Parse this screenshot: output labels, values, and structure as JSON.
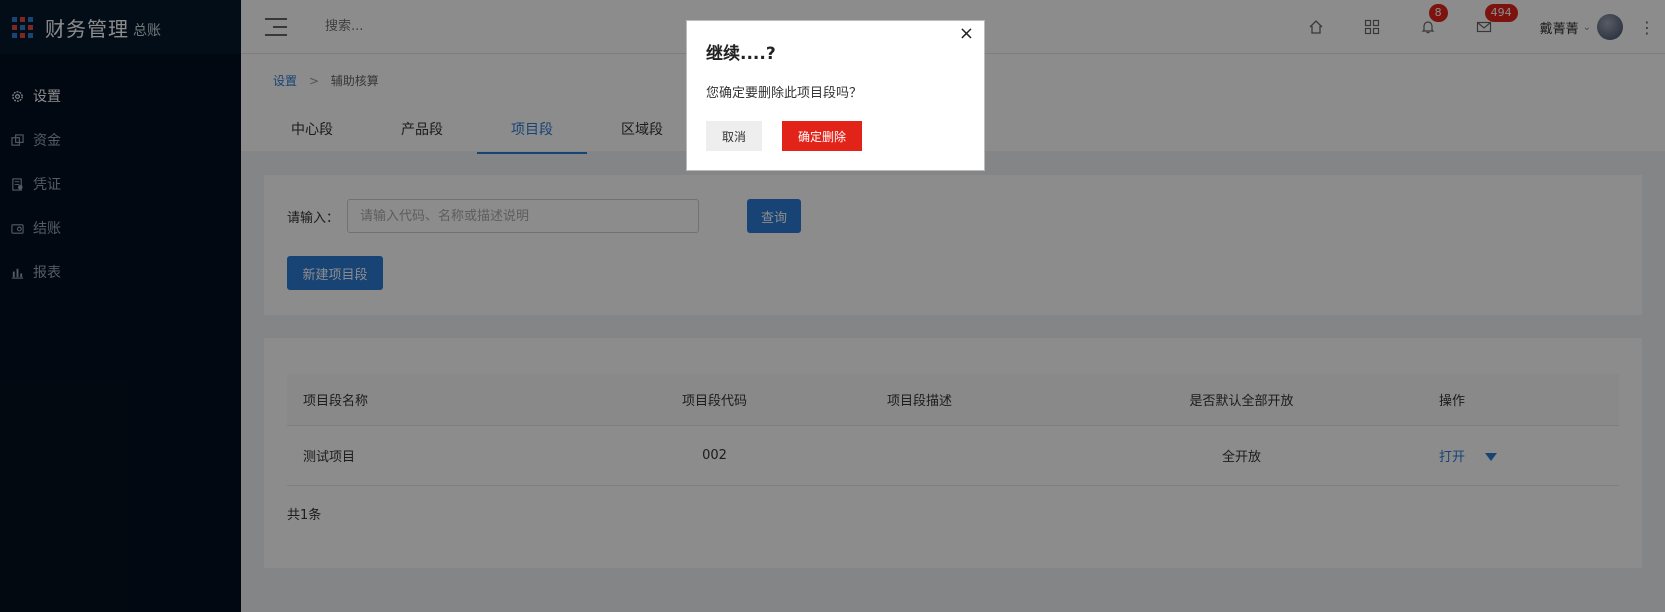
{
  "sidebar": {
    "title": "财务管理",
    "subtitle": "总账",
    "items": [
      {
        "label": "设置",
        "icon": "gear-icon",
        "active": true
      },
      {
        "label": "资金",
        "icon": "funds-icon",
        "active": false
      },
      {
        "label": "凭证",
        "icon": "voucher-icon",
        "active": false
      },
      {
        "label": "结账",
        "icon": "checkout-icon",
        "active": false
      },
      {
        "label": "报表",
        "icon": "report-icon",
        "active": false
      }
    ]
  },
  "header": {
    "search_placeholder": "搜索...",
    "notifications_count": "8",
    "messages_count": "494",
    "user_name": "戴菁菁"
  },
  "breadcrumb": {
    "root": "设置",
    "current": "辅助核算"
  },
  "tabs": [
    {
      "label": "中心段",
      "active": false
    },
    {
      "label": "产品段",
      "active": false
    },
    {
      "label": "项目段",
      "active": true
    },
    {
      "label": "区域段",
      "active": false
    }
  ],
  "filter": {
    "label": "请输入：",
    "placeholder": "请输入代码、名称或描述说明",
    "query_button": "查询",
    "new_button": "新建项目段"
  },
  "table": {
    "columns": [
      "项目段名称",
      "项目段代码",
      "项目段描述",
      "是否默认全部开放",
      "操作"
    ],
    "rows": [
      {
        "name": "测试项目",
        "code": "002",
        "description": "",
        "open": "全开放",
        "action": "打开"
      }
    ],
    "total": "共1条"
  },
  "modal": {
    "title": "继续....?",
    "message": "您确定要删除此项目段吗？",
    "cancel": "取消",
    "confirm": "确定删除",
    "close": "×"
  },
  "colors": {
    "accent": "#2b7bd6",
    "danger": "#e2231a",
    "sidebar_bg": "#03101f"
  }
}
